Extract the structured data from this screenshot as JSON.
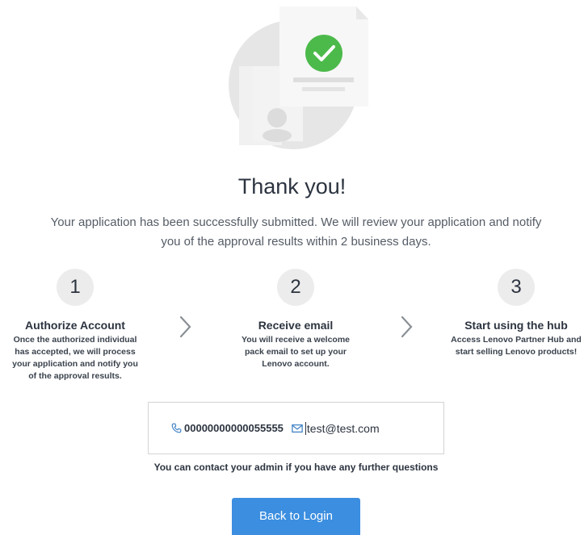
{
  "hero": {
    "illustration": "document-check-illustration"
  },
  "heading": {
    "title": "Thank you!"
  },
  "message": {
    "line1": "Your application has been successfully submitted. We will review your application and notify",
    "line2": "you of the approval results within 2 business days."
  },
  "steps": [
    {
      "number": "1",
      "title": "Authorize Account",
      "desc_lines": [
        "Once the authorized individual",
        "has accepted, we will process",
        "your application and notify you",
        "of the approval results."
      ]
    },
    {
      "number": "2",
      "title": "Receive email",
      "desc_lines": [
        "You will receive a welcome",
        "pack email to set up your",
        "Lenovo account."
      ]
    },
    {
      "number": "3",
      "title": "Start using the hub",
      "desc_lines": [
        "Access Lenovo Partner Hub and",
        "start selling Lenovo products!"
      ]
    }
  ],
  "contact": {
    "phone": "00000000000055555",
    "email": "test@test.com",
    "help": "You can contact your admin if you have any further questions"
  },
  "actions": {
    "back_label": "Back to Login"
  },
  "colors": {
    "accent": "#3b8ee0",
    "success": "#4cba4a",
    "icon": "#3b7fc4",
    "text": "#2c3440"
  }
}
